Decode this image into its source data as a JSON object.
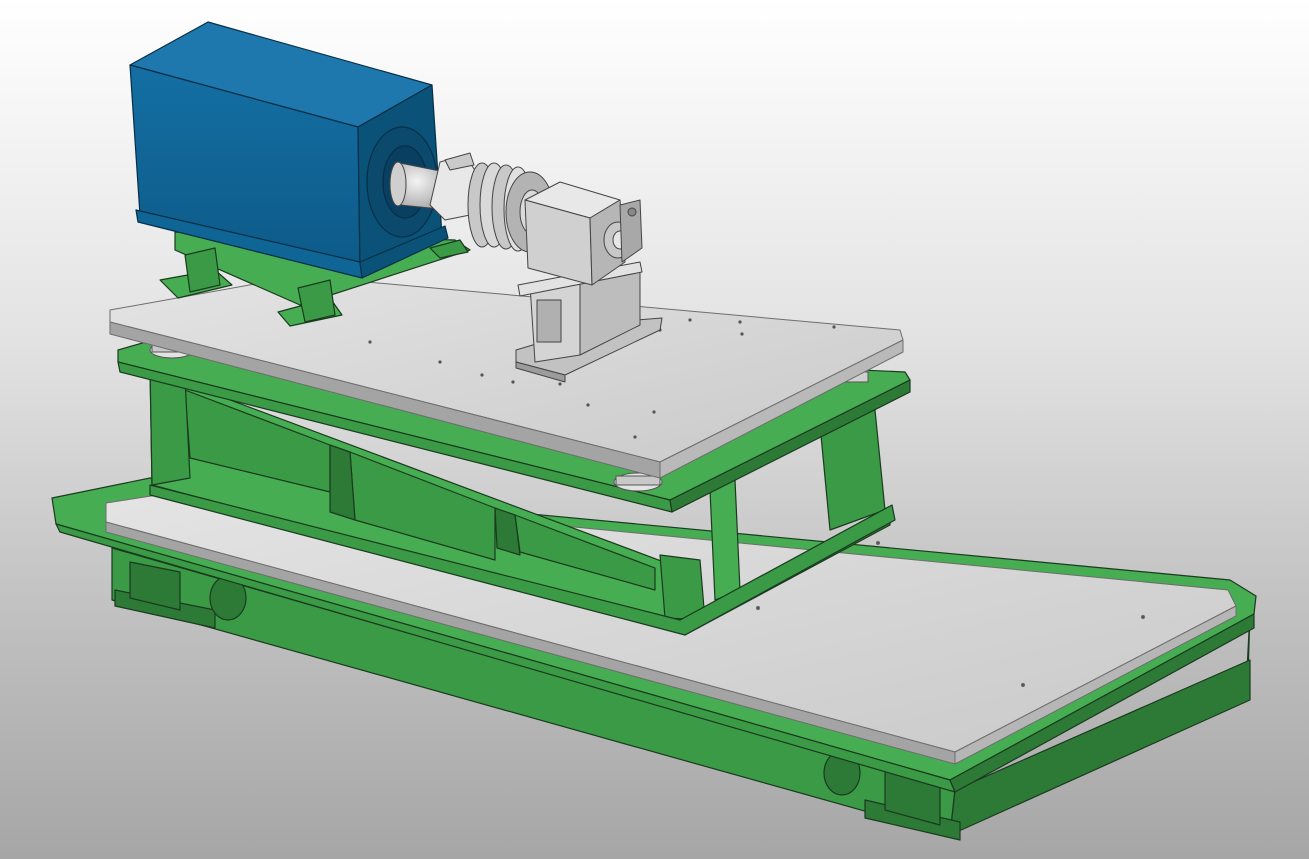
{
  "viewport": {
    "background": [
      "#ffffff",
      "#e2e2e2",
      "#bdbdbd",
      "#a6a6a6"
    ]
  },
  "model": {
    "parts": [
      "base-frame",
      "base-top-plate",
      "support-frame",
      "mounting-plate",
      "motor",
      "motor-feet",
      "flexible-coupling",
      "gearbox",
      "gearbox-bracket",
      "isolator-mounts"
    ],
    "colors": {
      "green_light": "#47ad52",
      "green_mid": "#3a9a45",
      "green_dark": "#2c7a36",
      "plate_top": "#d5d5d5",
      "plate_edge": "#9a9a9a",
      "motor_blue": "#0e6596",
      "motor_blue_dark": "#0a5278",
      "metal_light": "#e3e3e3",
      "metal_dark": "#a8a8a8",
      "outline": "#1b3a1f"
    }
  }
}
